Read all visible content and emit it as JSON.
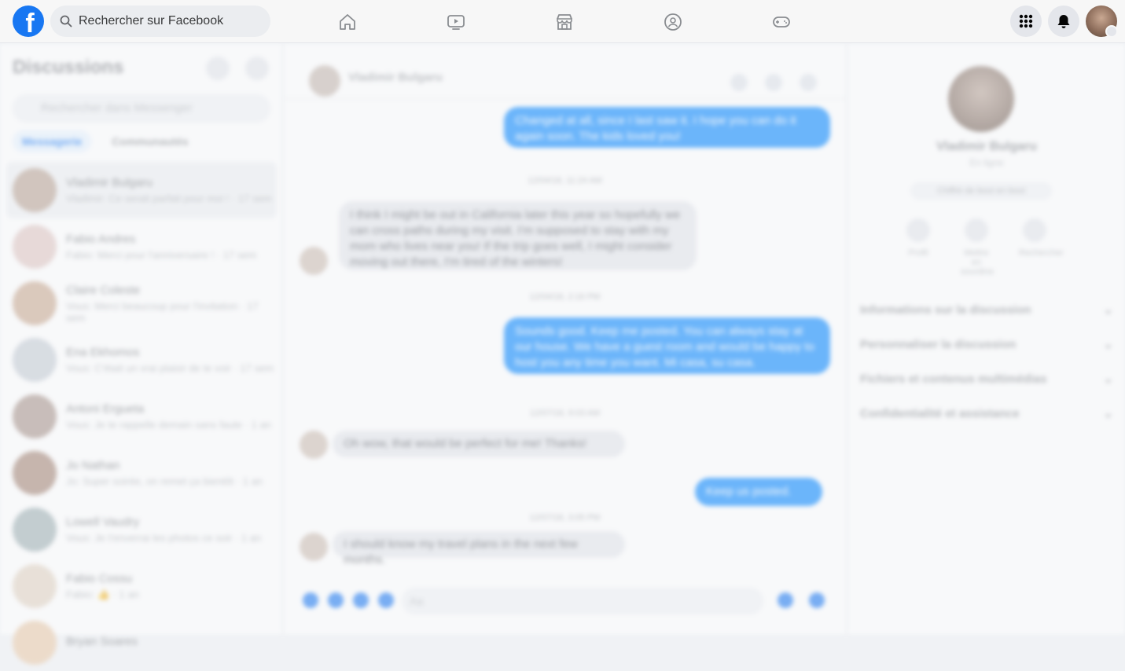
{
  "topbar": {
    "logo_icon": "facebook-logo",
    "logo_letter": "f",
    "search_placeholder": "Rechercher sur Facebook",
    "nav_icons": [
      "home-icon",
      "watch-video-icon",
      "marketplace-icon",
      "groups-icon",
      "gaming-icon"
    ],
    "right_icons": [
      "menu-grid-icon",
      "notifications-bell-icon",
      "profile-avatar"
    ]
  },
  "colors": {
    "brand_blue": "#1877f2",
    "topbar_bg": "#f7f7f7",
    "circle_btn_bg": "#e4e6eb",
    "icon_gray": "#8a8d91"
  },
  "sidebar": {
    "title": "Discussions",
    "search_placeholder": "Rechercher dans Messenger",
    "tabs": [
      "Messagerie",
      "Communautés"
    ],
    "conversations": [
      {
        "name": "Vladimir Bulgaru",
        "preview": "Vladimir: Ce serait parfait pour moi ! · 17 sem"
      },
      {
        "name": "Fabio Andres",
        "preview": "Fabio: Merci pour l'anniversaire ! · 17 sem"
      },
      {
        "name": "Claire Coleste",
        "preview": "Vous: Merci beaucoup pour l'invitation · 17 sem"
      },
      {
        "name": "Ena Ekhomos",
        "preview": "Vous: C'était un vrai plaisir de te voir · 17 sem"
      },
      {
        "name": "Antoni Ergueta",
        "preview": "Vous: Je te rappelle demain sans faute · 1 an"
      },
      {
        "name": "Jo Nathan",
        "preview": "Jo: Super soirée, on remet ça bientôt · 1 an"
      },
      {
        "name": "Lowell Vaudry",
        "preview": "Vous: Je t'enverrai les photos ce soir · 1 an"
      },
      {
        "name": "Fabio Cossu",
        "preview": "Fabio: 👍 · 1 an"
      },
      {
        "name": "Bryan Soares",
        "preview": ""
      }
    ]
  },
  "chat": {
    "contact_name": "Vladimir Bulgaru",
    "messages": [
      {
        "side": "out",
        "text": "Changed at all, since I last saw it. I hope you can do it again soon. The kids loved you!"
      },
      {
        "side": "ts",
        "text": "12/04/18, 11:24 AM"
      },
      {
        "side": "in",
        "text": "I think I might be out in California later this year so hopefully we can cross paths during my visit. I'm supposed to stay with my mom who lives near you! If the trip goes well, I might consider moving out there, I'm tired of the winters!"
      },
      {
        "side": "ts",
        "text": "12/04/18, 2:16 PM"
      },
      {
        "side": "out",
        "text": "Sounds good. Keep me posted. You can always stay at our house. We have a guest room and would be happy to host you any time you want. Mi casa, su casa."
      },
      {
        "side": "ts",
        "text": "12/07/18, 9:03 AM"
      },
      {
        "side": "in",
        "text": "Oh wow, that would be perfect for me! Thanks!"
      },
      {
        "side": "out",
        "text": "Keep us posted."
      },
      {
        "side": "ts",
        "text": "12/07/18, 3:05 PM"
      },
      {
        "side": "in",
        "text": "I should know my travel plans in the next few months."
      }
    ],
    "composer_placeholder": "Aa"
  },
  "rightpanel": {
    "name": "Vladimir Bulgaru",
    "status": "En ligne",
    "badge": "Chiffré de bout en bout",
    "actions": [
      "Profil",
      "Mettre en sourdine",
      "Rechercher"
    ],
    "menu": [
      "Informations sur la discussion",
      "Personnaliser la discussion",
      "Fichiers et contenus multimédias",
      "Confidentialité et assistance"
    ]
  }
}
